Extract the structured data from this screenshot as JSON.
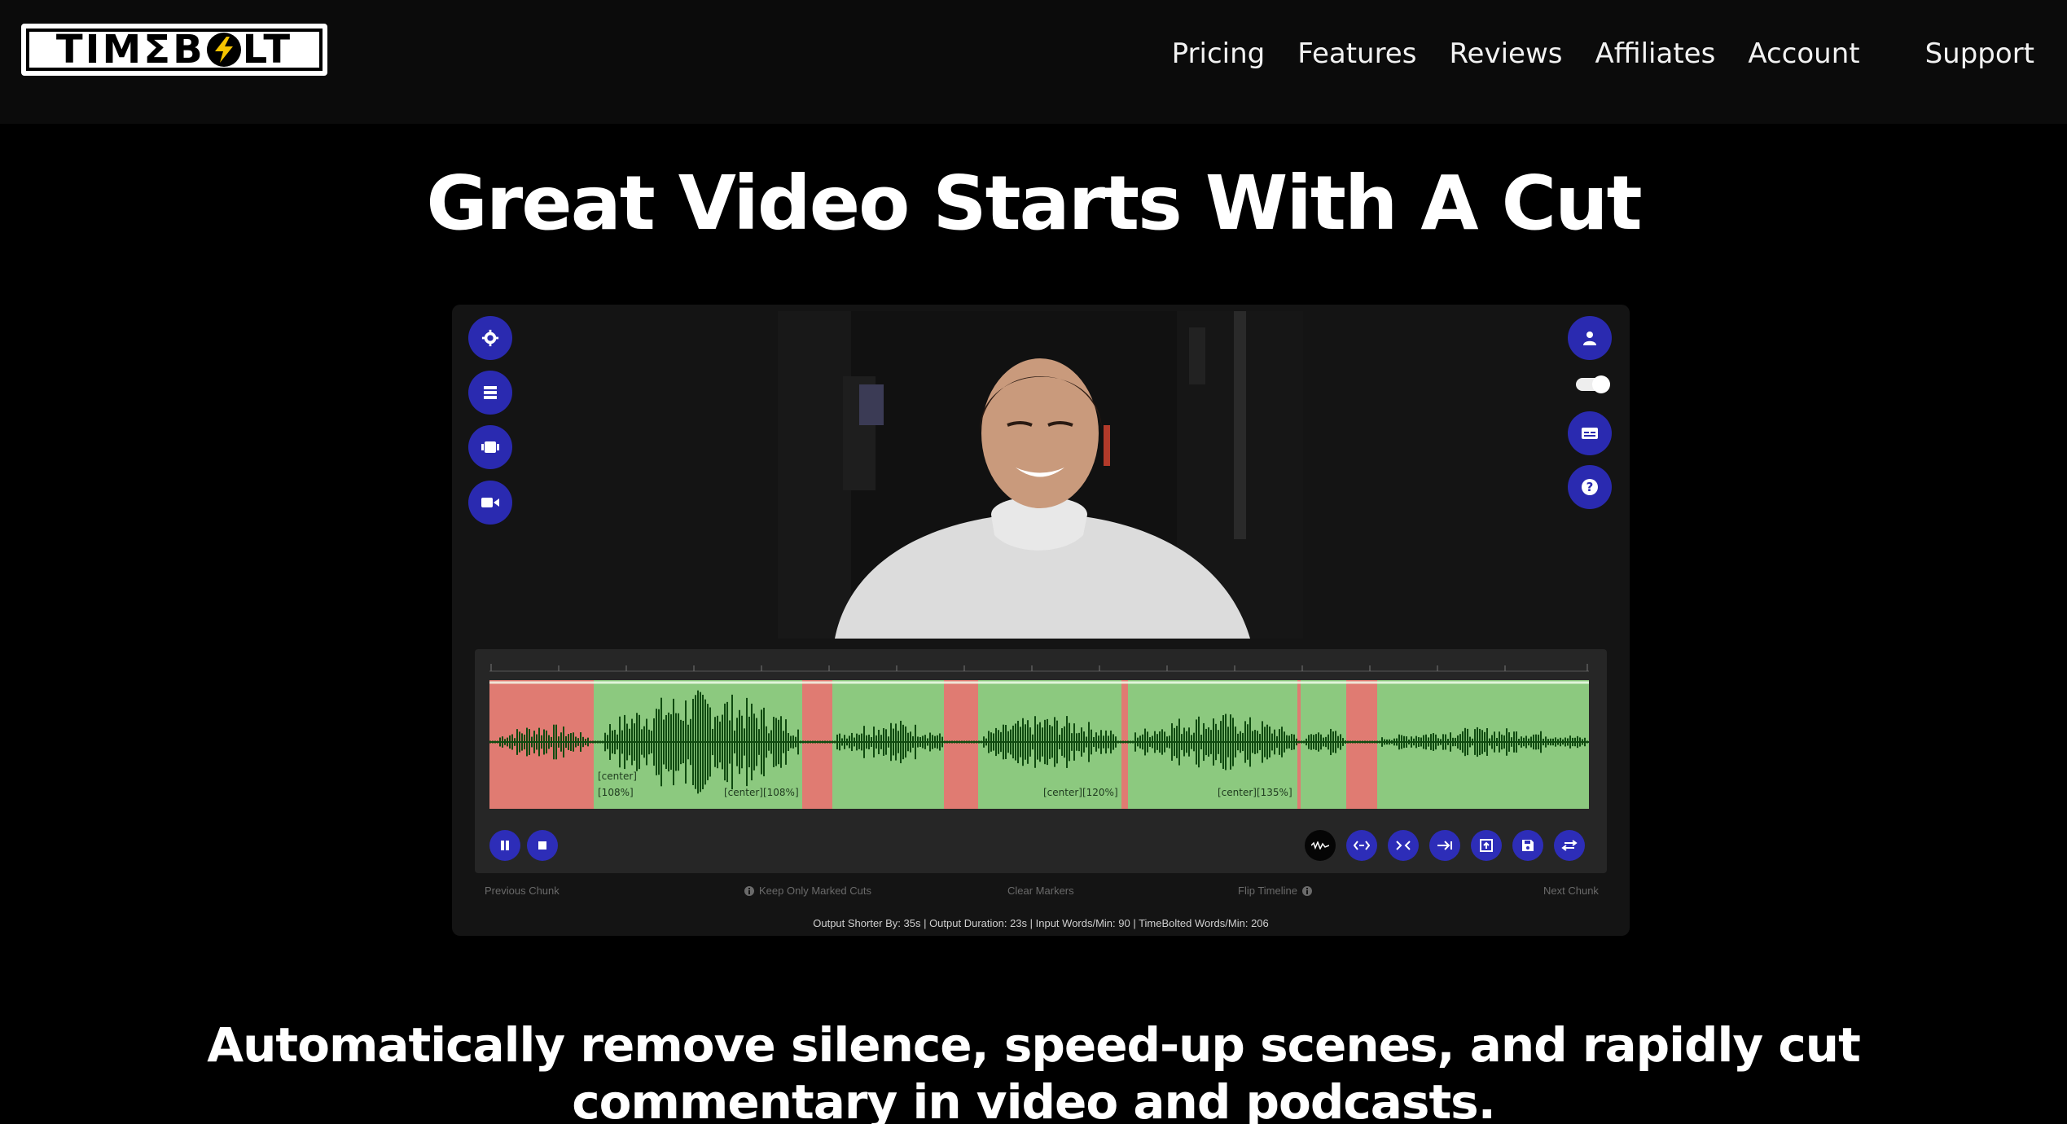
{
  "header": {
    "logo_prefix": "TIMΣB",
    "logo_suffix": "LT",
    "nav": [
      {
        "label": "Pricing"
      },
      {
        "label": "Features"
      },
      {
        "label": "Reviews"
      },
      {
        "label": "Affiliates"
      },
      {
        "label": "Account"
      },
      {
        "label": "Support"
      }
    ]
  },
  "hero": {
    "title": "Great Video Starts With A Cut"
  },
  "mockup": {
    "left_icons": [
      "gear-icon",
      "list-icon",
      "film-icon",
      "camera-icon"
    ],
    "right_icons": [
      "user-icon",
      "toggle-switch",
      "captions-icon",
      "help-icon"
    ],
    "timeline": {
      "segment_labels": [
        "[center][108%]",
        "[center][108%]",
        "[center][120%]",
        "[center][135%]"
      ],
      "first_label_line1": "[center]",
      "first_label_line2": "[108%]"
    },
    "controls_left": [
      "pause-icon",
      "stop-icon"
    ],
    "controls_right": [
      "waveform-icon",
      "expand-icon",
      "collapse-icon",
      "skip-end-icon",
      "export-icon",
      "save-icon",
      "swap-icon"
    ],
    "footer": {
      "previous_chunk": "Previous Chunk",
      "keep_marked": "Keep Only Marked Cuts",
      "clear_markers": "Clear Markers",
      "flip_timeline": "Flip Timeline",
      "next_chunk": "Next Chunk"
    },
    "stats": "Output Shorter By: 35s | Output Duration: 23s | Input Words/Min: 90 | TimeBolted Words/Min: 206",
    "colors": {
      "keep": "#8cc97f",
      "cut": "#e07b72",
      "wave": "#0f4a10",
      "button": "#2a2ab0"
    }
  },
  "subtitle": {
    "line1": "Automatically remove silence, speed-up scenes, and rapidly cut",
    "line2": "commentary in video and podcasts."
  }
}
